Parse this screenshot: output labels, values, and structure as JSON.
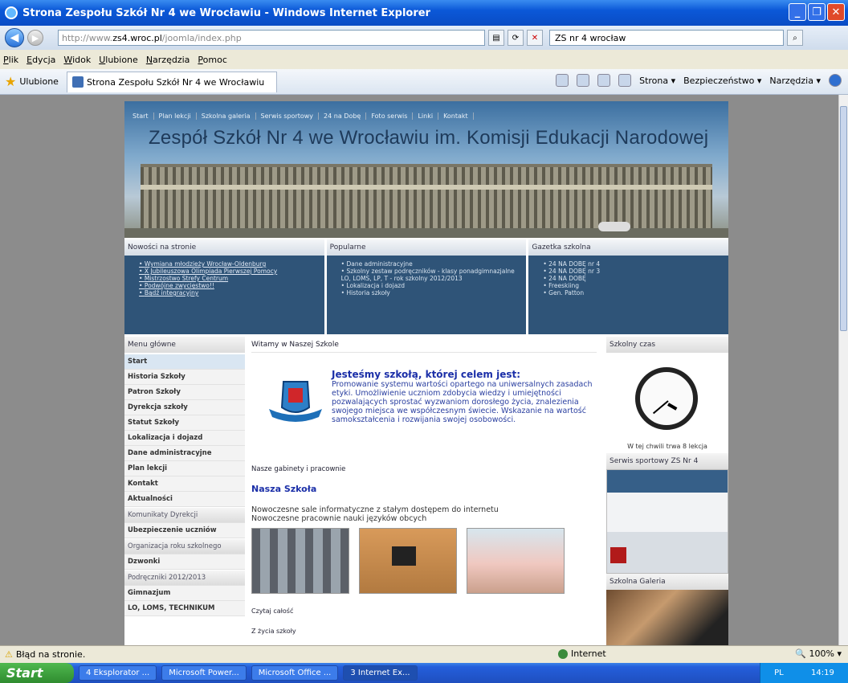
{
  "window": {
    "title": "Strona Zespołu Szkół Nr 4 we Wrocławiu - Windows Internet Explorer"
  },
  "address": {
    "url_prefix": "http://www.",
    "url_domain": "zs4.wroc.pl",
    "url_path": "/joomla/index.php",
    "search_value": "ZS nr 4 wrocław"
  },
  "menu": [
    "Plik",
    "Edycja",
    "Widok",
    "Ulubione",
    "Narzędzia",
    "Pomoc"
  ],
  "favorites": {
    "label": "Ulubione",
    "tab_title": "Strona Zespołu Szkół Nr 4 we Wrocławiu"
  },
  "commandbar": {
    "page": "Strona ▾",
    "safety": "Bezpieczeństwo ▾",
    "tools": "Narzędzia ▾"
  },
  "site": {
    "topnav": [
      "Start",
      "Plan lekcji",
      "Szkolna galeria",
      "Serwis sportowy",
      "24 na Dobę",
      "Foto serwis",
      "Linki",
      "Kontakt"
    ],
    "title": "Zespół Szkół Nr 4 we Wrocławiu im. Komisji Edukacji Narodowej",
    "box1": {
      "title": "Nowości na stronie",
      "items": [
        "Wymiana młodzieży Wrocław-Oldenburg",
        "X Jubileuszowa Olimpiada Pierwszej Pomocy",
        "Mistrzostwo Strefy Centrum",
        "Podwójne zwycięstwo!!",
        "Bądź integracyjny"
      ]
    },
    "box2": {
      "title": "Popularne",
      "items": [
        "Dane administracyjne",
        "Szkolny zestaw podręczników - klasy ponadgimnazjalne LO, LOMS, LP, T - rok szkolny 2012/2013",
        "Lokalizacja i dojazd",
        "Historia szkoły"
      ]
    },
    "box3": {
      "title": "Gazetka szkolna",
      "items": [
        "24 NA DOBĘ nr 4",
        "24 NA DOBĘ nr 3",
        "24 NA DOBĘ",
        "Freeskiing",
        "Gen. Patton"
      ]
    },
    "left_menu": {
      "title": "Menu główne",
      "items": [
        "Start",
        "Historia Szkoły",
        "Patron Szkoły",
        "Dyrekcja szkoły",
        "Statut Szkoły",
        "Lokalizacja i dojazd",
        "Dane administracyjne",
        "Plan lekcji",
        "Kontakt",
        "Aktualności"
      ],
      "section1": "Komunikaty Dyrekcji",
      "item_s1": "Ubezpieczenie uczniów",
      "section2": "Organizacja roku szkolnego",
      "item_s2": "Dzwonki",
      "section3": "Podręczniki 2012/2013",
      "item_s3a": "Gimnazjum",
      "item_s3b": "LO, LOMS, TECHNIKUM"
    },
    "center": {
      "heading": "Witamy w Naszej Szkole",
      "headline": "Jesteśmy szkołą, której celem jest:",
      "paragraph": "Promowanie systemu wartości opartego na uniwersalnych zasadach etyki. Umożliwienie uczniom zdobycia wiedzy i umiejętności pozwalających sprostać wyzwaniom dorosłego życia, znalezienia swojego miejsca we współczesnym świecie. Wskazanie na wartość samokształcenia i rozwijania swojej osobowości.",
      "sublink": "Nasze gabinety i pracownie",
      "nasza": "Nasza Szkoła",
      "desc1": "Nowoczesne sale informatyczne z stałym dostępem do internetu",
      "desc2": "Nowoczesne pracownie nauki języków obcych",
      "readmore": "Czytaj całość",
      "zycia": "Z życia szkoły"
    },
    "right": {
      "clock_title": "Szkolny czas",
      "lekcja": "W tej chwili trwa 8 lekcja",
      "sport_title": "Serwis sportowy ZS Nr 4",
      "gallery_title": "Szkolna Galeria"
    }
  },
  "status": {
    "error": "Błąd na stronie.",
    "zone": "Internet",
    "zoom": "100%"
  },
  "taskbar": {
    "start": "Start",
    "buttons": [
      "4 Eksplorator ...",
      "Microsoft Power...",
      "Microsoft Office ...",
      "3 Internet Ex..."
    ],
    "lang": "PL",
    "time": "14:19"
  }
}
